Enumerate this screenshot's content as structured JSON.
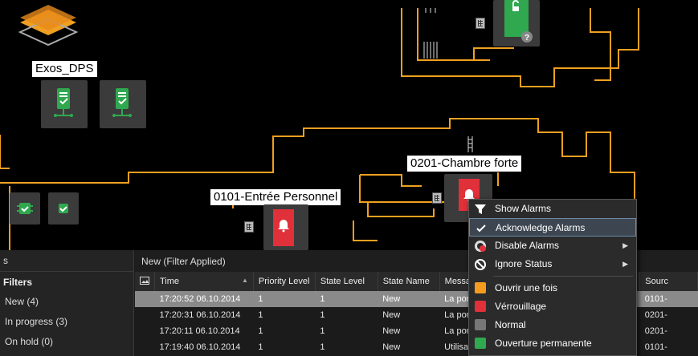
{
  "map": {
    "labels": {
      "exos": "Exos_DPS",
      "chambre": "0201-Chambre forte",
      "entree": "0101-Entrée Personnel"
    }
  },
  "panel": {
    "left_header": "s",
    "filters_title": "Filters",
    "filters": [
      "New (4)",
      "In progress (3)",
      "On hold (0)"
    ],
    "grid_title": "New (Filter Applied)",
    "columns": [
      "Time",
      "Priority Level",
      "State Level",
      "State Name",
      "Messa",
      "Sourc"
    ],
    "rows": [
      {
        "time": "17:20:52 06.10.2014",
        "priority": "1",
        "state_level": "1",
        "state_name": "New",
        "message": "La por",
        "source": "0101-"
      },
      {
        "time": "17:20:31 06.10.2014",
        "priority": "1",
        "state_level": "1",
        "state_name": "New",
        "message": "La por",
        "source": "0201-"
      },
      {
        "time": "17:20:11 06.10.2014",
        "priority": "1",
        "state_level": "1",
        "state_name": "New",
        "message": "La por",
        "source": "0201-"
      },
      {
        "time": "17:19:40 06.10.2014",
        "priority": "1",
        "state_level": "1",
        "state_name": "New",
        "message": "Utilisa",
        "source": "0101-"
      }
    ]
  },
  "context_menu": {
    "items": [
      {
        "label": "Show Alarms",
        "icon": "filter-icon"
      },
      {
        "label": "Acknowledge Alarms",
        "icon": "check-icon"
      },
      {
        "label": "Disable Alarms",
        "icon": "disable-alarm-icon",
        "submenu": true
      },
      {
        "label": "Ignore Status",
        "icon": "block-icon",
        "submenu": true
      },
      {
        "label": "Ouvrir une fois",
        "icon": "door-open-icon",
        "color": "#f39c1f"
      },
      {
        "label": "Vérrouillage",
        "icon": "lock-icon",
        "color": "#e0303a"
      },
      {
        "label": "Normal",
        "icon": "check-icon",
        "color": "#777777"
      },
      {
        "label": "Ouverture permanente",
        "icon": "open-permanent-icon",
        "color": "#2fa84f"
      }
    ]
  },
  "colors": {
    "wall": "#f0a020",
    "alarm_red": "#e0303a",
    "ok_green": "#2fa84f",
    "tile_gray": "#3b3b3b"
  }
}
